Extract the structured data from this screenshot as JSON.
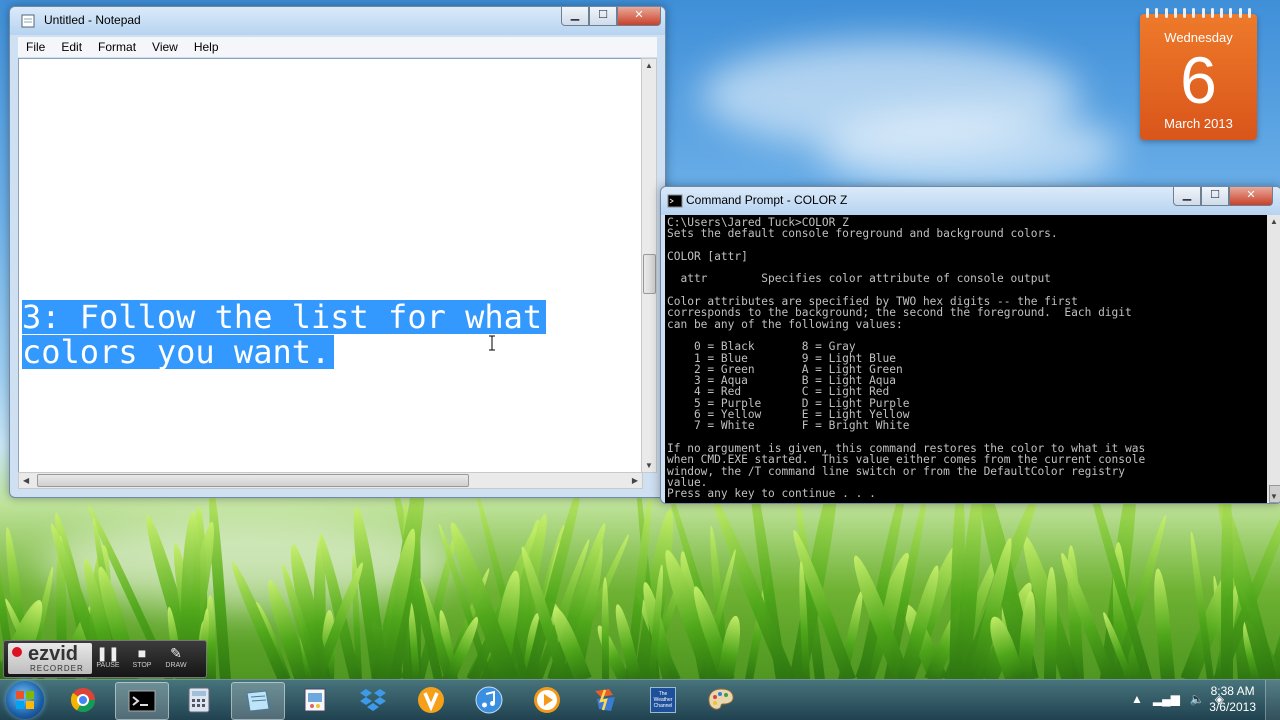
{
  "notepad": {
    "title": "Untitled - Notepad",
    "menu": [
      "File",
      "Edit",
      "Format",
      "View",
      "Help"
    ],
    "selected_lines": [
      "3: Follow the list for what",
      "colors you want."
    ]
  },
  "cmd": {
    "title": "Command Prompt - COLOR Z",
    "output": "C:\\Users\\Jared Tuck>COLOR Z\nSets the default console foreground and background colors.\n\nCOLOR [attr]\n\n  attr        Specifies color attribute of console output\n\nColor attributes are specified by TWO hex digits -- the first\ncorresponds to the background; the second the foreground.  Each digit\ncan be any of the following values:\n\n    0 = Black       8 = Gray\n    1 = Blue        9 = Light Blue\n    2 = Green       A = Light Green\n    3 = Aqua        B = Light Aqua\n    4 = Red         C = Light Red\n    5 = Purple      D = Light Purple\n    6 = Yellow      E = Light Yellow\n    7 = White       F = Bright White\n\nIf no argument is given, this command restores the color to what it was\nwhen CMD.EXE started.  This value either comes from the current console\nwindow, the /T command line switch or from the DefaultColor registry\nvalue.\nPress any key to continue . . ."
  },
  "calendar": {
    "weekday": "Wednesday",
    "day": "6",
    "month_year": "March 2013"
  },
  "ezvid": {
    "logo": "ezvid",
    "logo_sub": "RECORDER",
    "pause": "PAUSE",
    "stop": "STOP",
    "draw": "DRAW"
  },
  "taskbar": {
    "time": "8:38 AM",
    "date": "3/6/2013",
    "weather_label": "The Weather Channel",
    "apps": [
      "chrome-icon",
      "cmd-icon",
      "calculator-icon",
      "notepad-icon",
      "paint-icon",
      "dropbox-icon",
      "vlc-v-icon",
      "itunes-icon",
      "media-player-icon",
      "flash-icon",
      "weather-icon",
      "paint-palette-icon"
    ]
  },
  "colors": {
    "selection": "#3399ff",
    "console_bg": "#000000",
    "console_fg": "#c0c0c0",
    "calendar": "#e8692a"
  }
}
